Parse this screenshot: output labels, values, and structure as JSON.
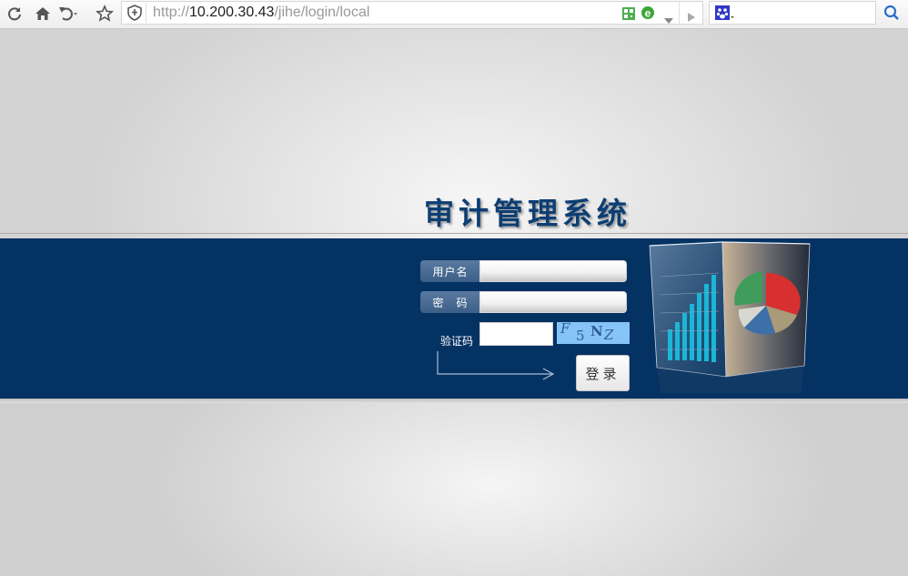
{
  "browser": {
    "url_protocol": "http://",
    "url_host": "10.200.30.43",
    "url_path": "/jihe/login/local",
    "icons": [
      "refresh-icon",
      "home-icon",
      "undo-icon",
      "star-icon",
      "shield-icon",
      "qr-code-icon",
      "ie-mode-icon",
      "forward-icon",
      "search-engine-icon",
      "search-icon"
    ]
  },
  "page": {
    "title": "审计管理系统",
    "username_label": "用户名",
    "password_label": "密　码",
    "username_value": "",
    "password_value": "",
    "captcha_label": "验证码",
    "captcha_value": "",
    "captcha_chars": [
      "F",
      "5",
      "N",
      "Z"
    ],
    "login_button": "登录"
  },
  "colors": {
    "band": "#043263",
    "title": "#0d3e73",
    "captcha_bg": "#86c4f7"
  }
}
